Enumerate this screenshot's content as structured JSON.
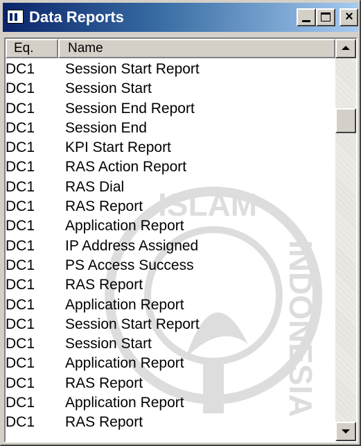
{
  "window": {
    "title": "Data Reports",
    "close_glyph": "×",
    "icon": "table-window-icon",
    "title_color": "#0a246a"
  },
  "table": {
    "columns": [
      "Eq.",
      "Name"
    ],
    "rows": [
      {
        "eq": "DC1",
        "name": "Session Start Report"
      },
      {
        "eq": "DC1",
        "name": "Session Start"
      },
      {
        "eq": "DC1",
        "name": "Session End Report"
      },
      {
        "eq": "DC1",
        "name": "Session End"
      },
      {
        "eq": "DC1",
        "name": "KPI Start Report"
      },
      {
        "eq": "DC1",
        "name": "RAS Action Report"
      },
      {
        "eq": "DC1",
        "name": "RAS Dial"
      },
      {
        "eq": "DC1",
        "name": "RAS Report"
      },
      {
        "eq": "DC1",
        "name": "Application Report"
      },
      {
        "eq": "DC1",
        "name": "IP Address Assigned"
      },
      {
        "eq": "DC1",
        "name": "PS Access Success"
      },
      {
        "eq": "DC1",
        "name": "RAS Report"
      },
      {
        "eq": "DC1",
        "name": "Application Report"
      },
      {
        "eq": "DC1",
        "name": "Session Start Report"
      },
      {
        "eq": "DC1",
        "name": "Session Start"
      },
      {
        "eq": "DC1",
        "name": "Application Report"
      },
      {
        "eq": "DC1",
        "name": "RAS Report"
      },
      {
        "eq": "DC1",
        "name": "Application Report"
      },
      {
        "eq": "DC1",
        "name": "RAS Report"
      }
    ]
  },
  "watermark": {
    "text_top": "ISLAM",
    "text_right": "INDONESIA"
  }
}
